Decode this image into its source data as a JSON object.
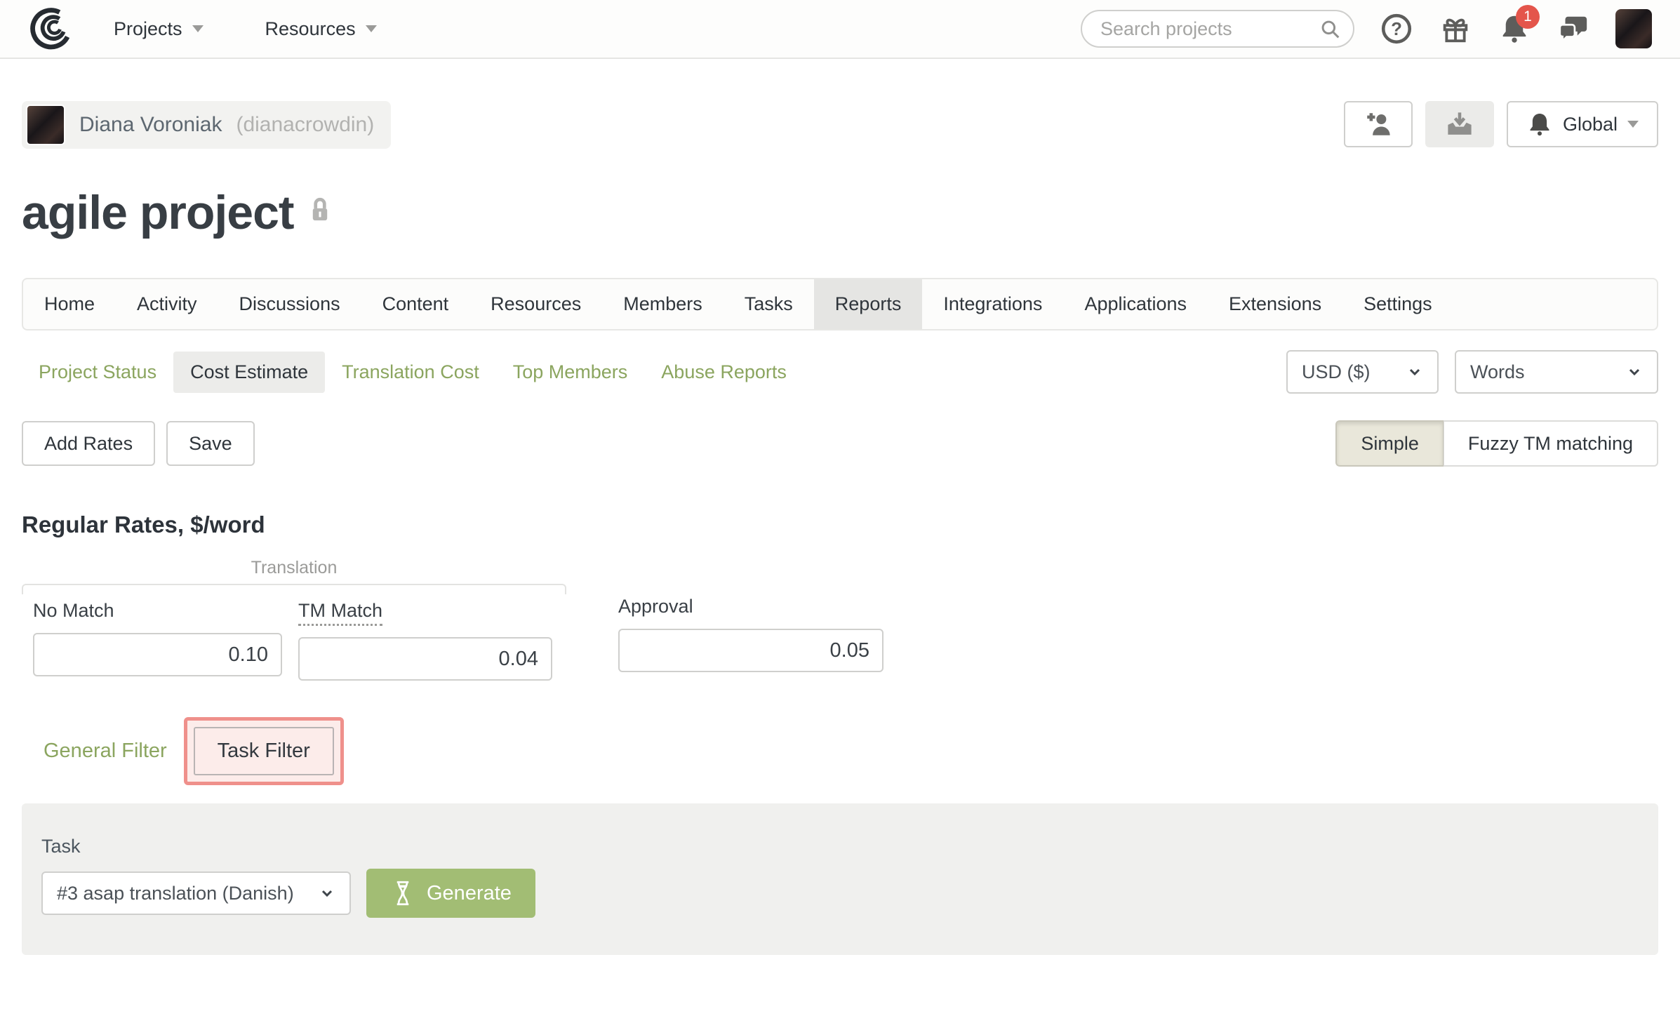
{
  "topbar": {
    "projects_label": "Projects",
    "resources_label": "Resources",
    "search_placeholder": "Search projects",
    "notification_count": "1"
  },
  "page_header": {
    "user_name": "Diana Voroniak",
    "user_handle": "(dianacrowdin)",
    "global_label": "Global",
    "project_title": "agile project"
  },
  "tabs": {
    "active": "Reports",
    "items": [
      "Home",
      "Activity",
      "Discussions",
      "Content",
      "Resources",
      "Members",
      "Tasks",
      "Reports",
      "Integrations",
      "Applications",
      "Extensions",
      "Settings"
    ]
  },
  "subtabs": {
    "active": "Cost Estimate",
    "items": [
      "Project Status",
      "Cost Estimate",
      "Translation Cost",
      "Top Members",
      "Abuse Reports"
    ]
  },
  "report_options": {
    "currency": "USD ($)",
    "unit": "Words"
  },
  "toolbar": {
    "add_rates_label": "Add Rates",
    "save_label": "Save",
    "simple_label": "Simple",
    "fuzzy_label": "Fuzzy TM matching"
  },
  "rates": {
    "heading": "Regular Rates, $/word",
    "group_label": "Translation",
    "no_match_label": "No Match",
    "no_match_value": "0.10",
    "tm_match_label": "TM Match",
    "tm_match_value": "0.04",
    "approval_label": "Approval",
    "approval_value": "0.05"
  },
  "filters": {
    "general_label": "General Filter",
    "task_label": "Task Filter"
  },
  "task_panel": {
    "task_label": "Task",
    "task_selected": "#3 asap translation (Danish)",
    "generate_label": "Generate"
  },
  "colors": {
    "accent_green": "#8ba55f",
    "button_green": "#a2bd74",
    "highlight_red": "#ef908b",
    "badge_red": "#e4554b"
  }
}
